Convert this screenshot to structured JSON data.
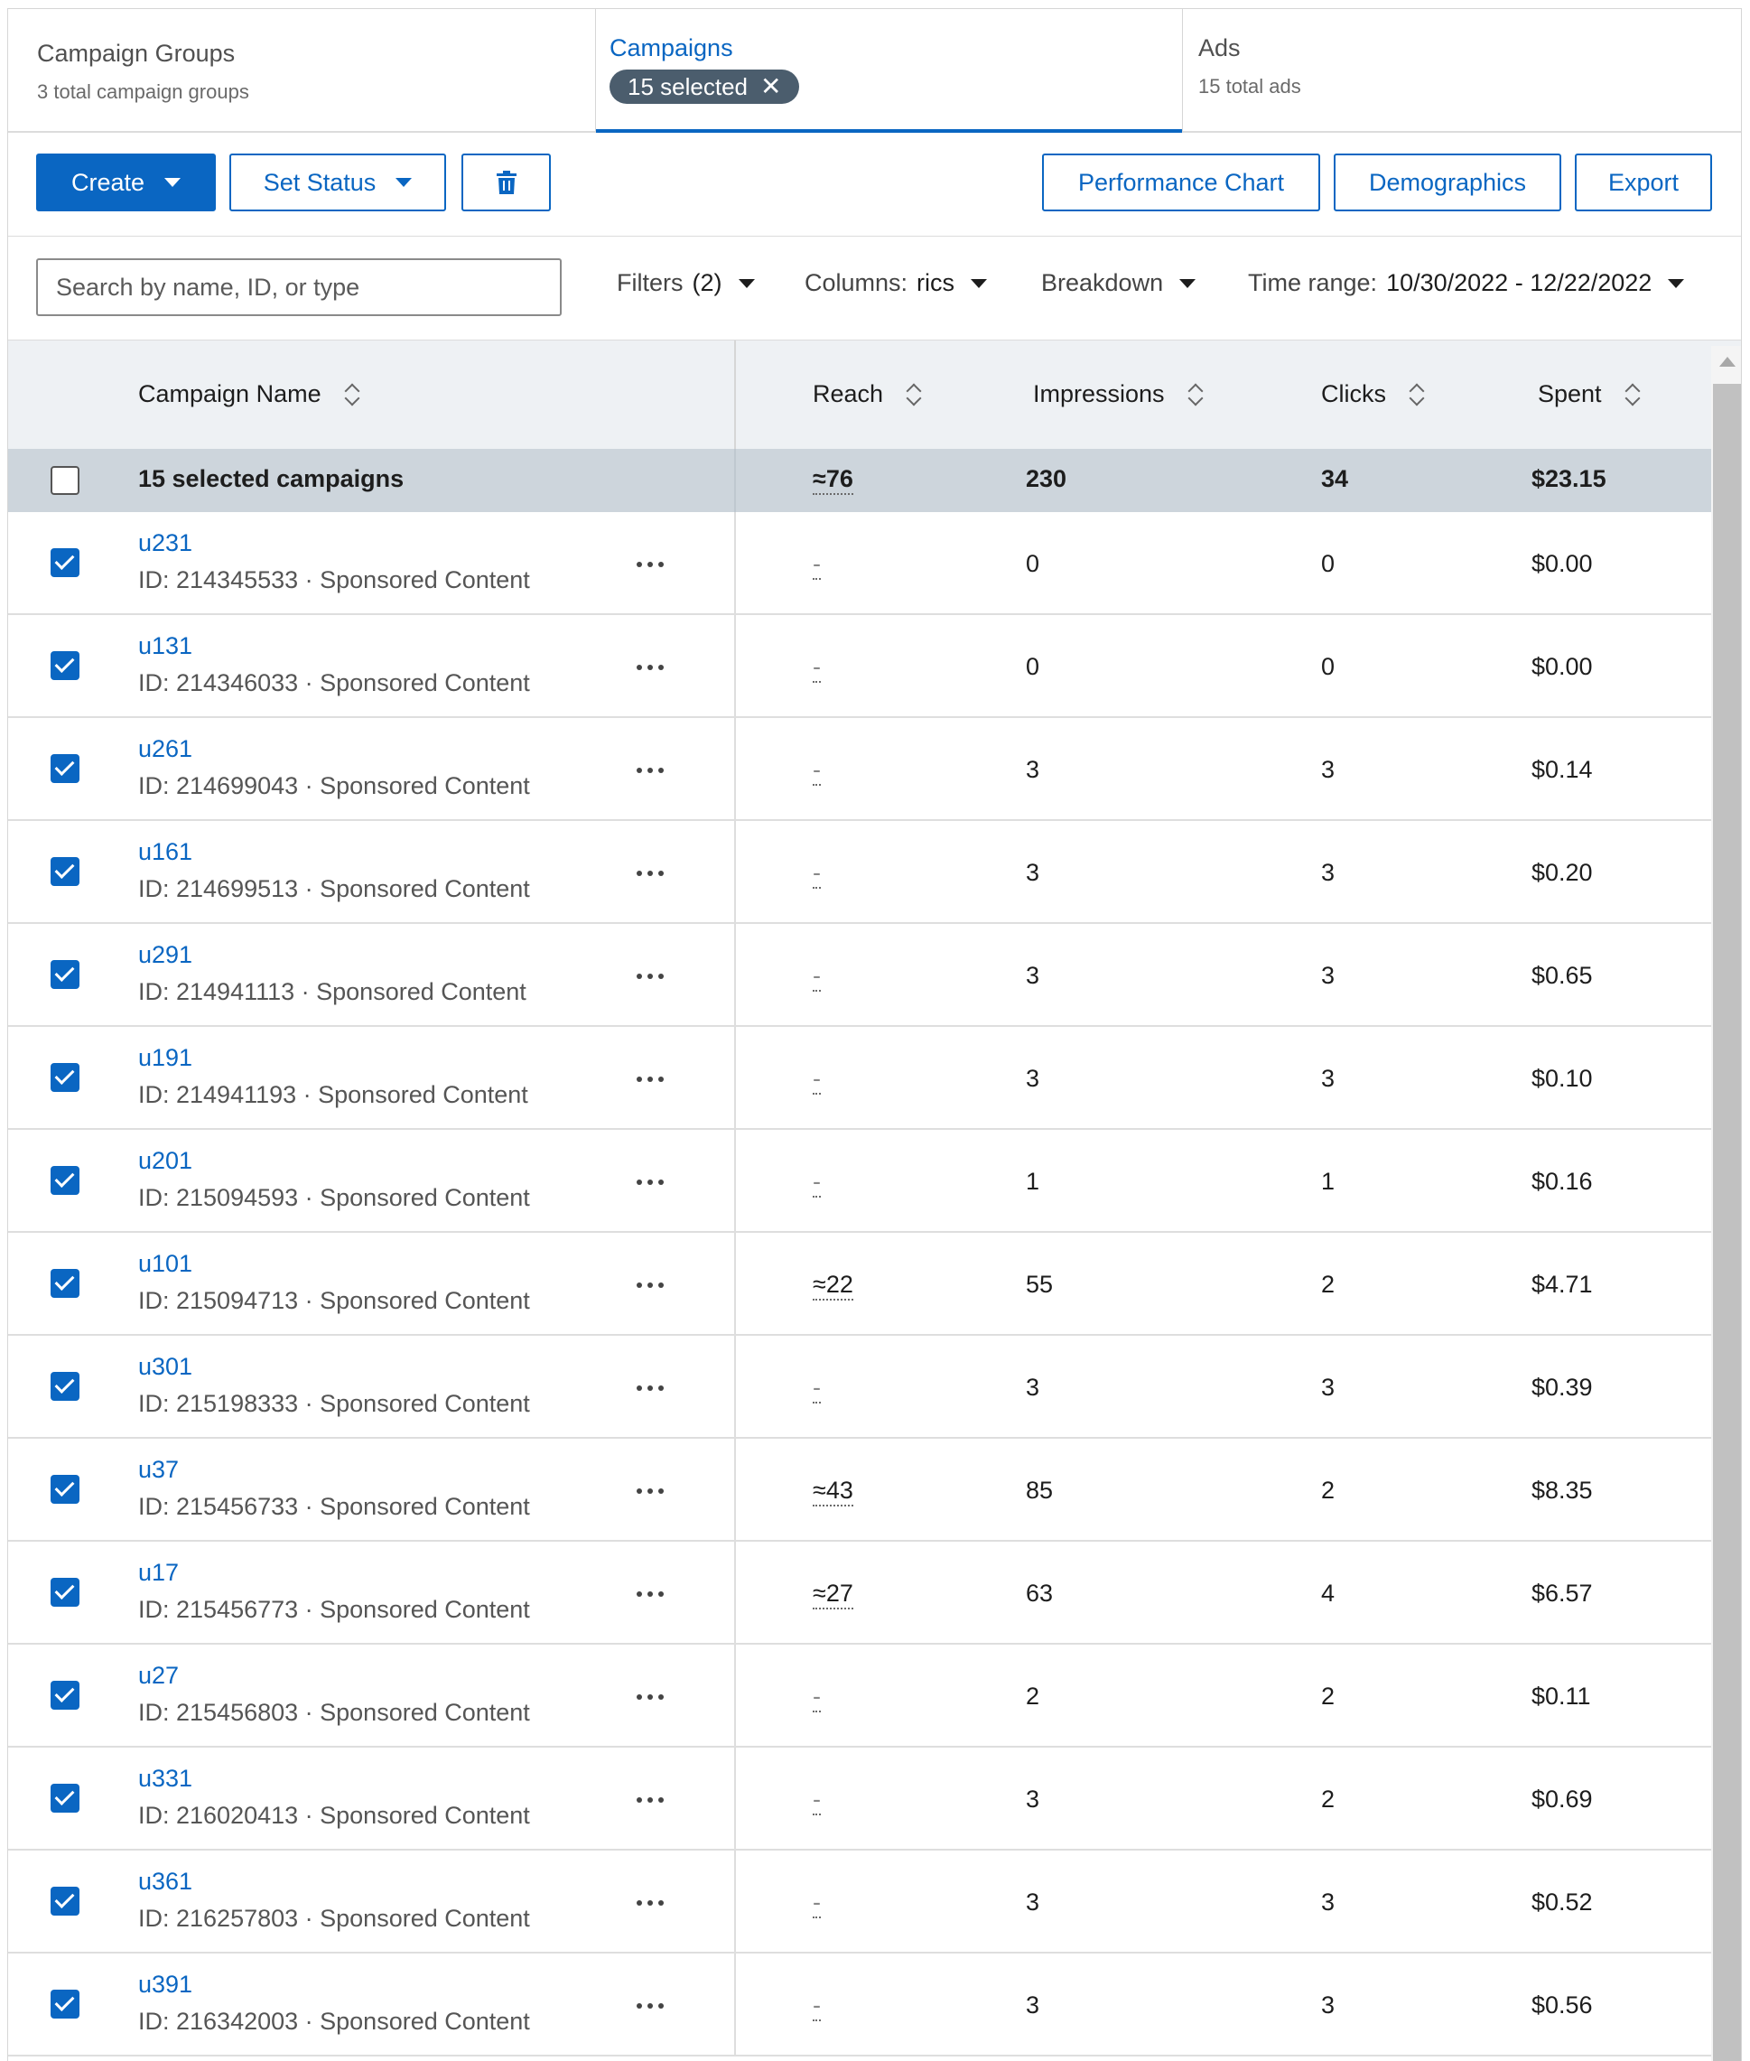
{
  "tabs": [
    {
      "title": "Campaign Groups",
      "sub": "3 total campaign groups"
    },
    {
      "title": "Campaigns",
      "pill": "15 selected",
      "pill_close": "✕"
    },
    {
      "title": "Ads",
      "sub": "15 total ads"
    }
  ],
  "toolbar": {
    "create": "Create",
    "set_status": "Set Status",
    "delete_icon": "trash-icon",
    "performance_chart": "Performance Chart",
    "demographics": "Demographics",
    "export": "Export"
  },
  "filterbar": {
    "search_placeholder": "Search by name, ID, or type",
    "filters_label": "Filters",
    "filters_count": "(2)",
    "columns_label": "Columns:",
    "columns_value": "rics",
    "breakdown": "Breakdown",
    "time_label": "Time range:",
    "time_value": "10/30/2022 - 12/22/2022"
  },
  "columns": {
    "name": "Campaign Name",
    "reach": "Reach",
    "impressions": "Impressions",
    "clicks": "Clicks",
    "spent": "Spent"
  },
  "summary": {
    "label": "15 selected campaigns",
    "reach": "≈76",
    "impressions": "230",
    "clicks": "34",
    "spent": "$23.15"
  },
  "rows": [
    {
      "name": "u231",
      "meta": "ID: 214345533 · Sponsored Content",
      "reach": "-",
      "impressions": "0",
      "clicks": "0",
      "spent": "$0.00"
    },
    {
      "name": "u131",
      "meta": "ID: 214346033 · Sponsored Content",
      "reach": "-",
      "impressions": "0",
      "clicks": "0",
      "spent": "$0.00"
    },
    {
      "name": "u261",
      "meta": "ID: 214699043 · Sponsored Content",
      "reach": "-",
      "impressions": "3",
      "clicks": "3",
      "spent": "$0.14"
    },
    {
      "name": "u161",
      "meta": "ID: 214699513 · Sponsored Content",
      "reach": "-",
      "impressions": "3",
      "clicks": "3",
      "spent": "$0.20"
    },
    {
      "name": "u291",
      "meta": "ID: 214941113 · Sponsored Content",
      "reach": "-",
      "impressions": "3",
      "clicks": "3",
      "spent": "$0.65"
    },
    {
      "name": "u191",
      "meta": "ID: 214941193 · Sponsored Content",
      "reach": "-",
      "impressions": "3",
      "clicks": "3",
      "spent": "$0.10"
    },
    {
      "name": "u201",
      "meta": "ID: 215094593 · Sponsored Content",
      "reach": "-",
      "impressions": "1",
      "clicks": "1",
      "spent": "$0.16"
    },
    {
      "name": "u101",
      "meta": "ID: 215094713 · Sponsored Content",
      "reach": "≈22",
      "impressions": "55",
      "clicks": "2",
      "spent": "$4.71"
    },
    {
      "name": "u301",
      "meta": "ID: 215198333 · Sponsored Content",
      "reach": "-",
      "impressions": "3",
      "clicks": "3",
      "spent": "$0.39"
    },
    {
      "name": "u37",
      "meta": "ID: 215456733 · Sponsored Content",
      "reach": "≈43",
      "impressions": "85",
      "clicks": "2",
      "spent": "$8.35"
    },
    {
      "name": "u17",
      "meta": "ID: 215456773 · Sponsored Content",
      "reach": "≈27",
      "impressions": "63",
      "clicks": "4",
      "spent": "$6.57"
    },
    {
      "name": "u27",
      "meta": "ID: 215456803 · Sponsored Content",
      "reach": "-",
      "impressions": "2",
      "clicks": "2",
      "spent": "$0.11"
    },
    {
      "name": "u331",
      "meta": "ID: 216020413 · Sponsored Content",
      "reach": "-",
      "impressions": "3",
      "clicks": "2",
      "spent": "$0.69"
    },
    {
      "name": "u361",
      "meta": "ID: 216257803 · Sponsored Content",
      "reach": "-",
      "impressions": "3",
      "clicks": "3",
      "spent": "$0.52"
    },
    {
      "name": "u391",
      "meta": "ID: 216342003 · Sponsored Content",
      "reach": "-",
      "impressions": "3",
      "clicks": "3",
      "spent": "$0.56"
    }
  ],
  "colors": {
    "accent": "#0a66c2",
    "pill": "#4b5d6d",
    "summary_row": "#cdd5dc",
    "header_bg": "#eef1f4"
  }
}
